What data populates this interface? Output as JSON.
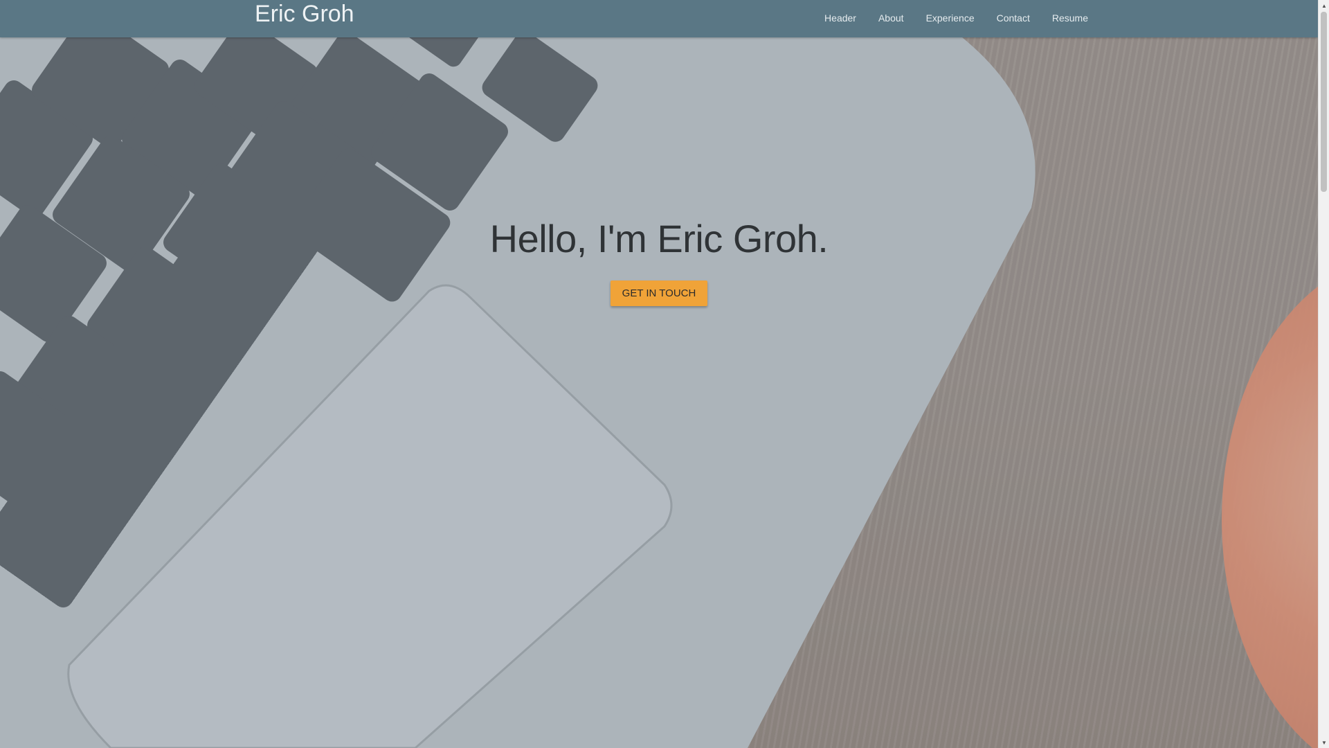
{
  "brand": "Eric Groh",
  "nav": {
    "items": [
      {
        "label": "Header"
      },
      {
        "label": "About"
      },
      {
        "label": "Experience"
      },
      {
        "label": "Contact"
      },
      {
        "label": "Resume"
      }
    ]
  },
  "hero": {
    "title": "Hello, I'm Eric Groh.",
    "cta_label": "GET IN TOUCH"
  },
  "colors": {
    "navbar": "#5a7785",
    "cta": "#f0a338",
    "title": "#2f3336"
  },
  "icons": {
    "scroll_up": "scroll-up-arrow-icon",
    "scroll_down": "scroll-down-arrow-icon"
  }
}
